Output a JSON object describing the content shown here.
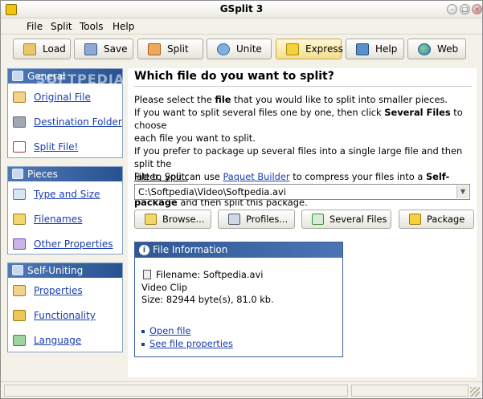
{
  "window": {
    "title": "GSplit 3"
  },
  "menu": [
    "File",
    "Split",
    "Tools",
    "Help"
  ],
  "toolbar": {
    "buttons": [
      {
        "label": "Load",
        "icon": "load-icon",
        "color": "#c8a04a"
      },
      {
        "label": "Save",
        "icon": "save-icon",
        "color": "#5b7fbf"
      },
      {
        "label": "Split",
        "icon": "split-icon",
        "color": "#d9822b"
      },
      {
        "label": "Unite",
        "icon": "unite-icon",
        "color": "#3f7fbf"
      },
      {
        "label": "Express",
        "icon": "express-icon",
        "color": "#e0b91e"
      },
      {
        "label": "Help",
        "icon": "help-book-icon",
        "color": "#2f6fa8"
      },
      {
        "label": "Web",
        "icon": "globe-icon",
        "color": "#3a8d3a"
      }
    ]
  },
  "sidebar": {
    "watermark": "SOFTPEDIA",
    "sections": [
      {
        "title": "General",
        "items": [
          {
            "label": "Original File",
            "icon": "original-file-icon"
          },
          {
            "label": "Destination Folder",
            "icon": "destination-folder-icon"
          },
          {
            "label": "Split File!",
            "icon": "scissors-icon"
          }
        ]
      },
      {
        "title": "Pieces",
        "items": [
          {
            "label": "Type and Size",
            "icon": "type-size-icon"
          },
          {
            "label": "Filenames",
            "icon": "filenames-icon"
          },
          {
            "label": "Other Properties",
            "icon": "other-properties-icon"
          }
        ]
      },
      {
        "title": "Self-Uniting",
        "items": [
          {
            "label": "Properties",
            "icon": "properties-icon"
          },
          {
            "label": "Functionality",
            "icon": "functionality-icon"
          },
          {
            "label": "Language",
            "icon": "language-icon"
          }
        ]
      }
    ]
  },
  "main": {
    "heading": "Which file do you want to split?",
    "para": {
      "l1a": "Please select the ",
      "l1b": "file",
      "l1c": " that you would like to split into smaller pieces.",
      "l2a": "If you want to split several files one by one, then click ",
      "l2b": "Several Files",
      "l2c": " to choose",
      "l3": "each file you want to split.",
      "l4": "If you prefer to package up several files into a single large file and then split the",
      "l5a": "latter, you can use ",
      "l5link": "Paquet Builder",
      "l5b": " to compress your files into a ",
      "l5c": "Self-Extracting",
      "l6a": "package",
      "l6b": " and then split this package."
    },
    "file_label": "File to Split:",
    "file_value": "C:\\Softpedia\\Video\\Softpedia.avi",
    "actions": [
      {
        "label": "Browse...",
        "icon": "browse-folder-icon"
      },
      {
        "label": "Profiles...",
        "icon": "profiles-icon"
      },
      {
        "label": "Several Files",
        "icon": "several-files-icon"
      },
      {
        "label": "Package",
        "icon": "package-icon"
      }
    ],
    "info": {
      "title": "File Information",
      "filename": "Filename: Softpedia.avi",
      "type": "Video Clip",
      "size": "Size: 82944 byte(s), 81.0 kb.",
      "link_open": "Open file",
      "link_props": "See file properties"
    }
  },
  "colors": {
    "panel_head": "#4f79b8",
    "link": "#1a3db0",
    "info_head": "#2f5895"
  }
}
